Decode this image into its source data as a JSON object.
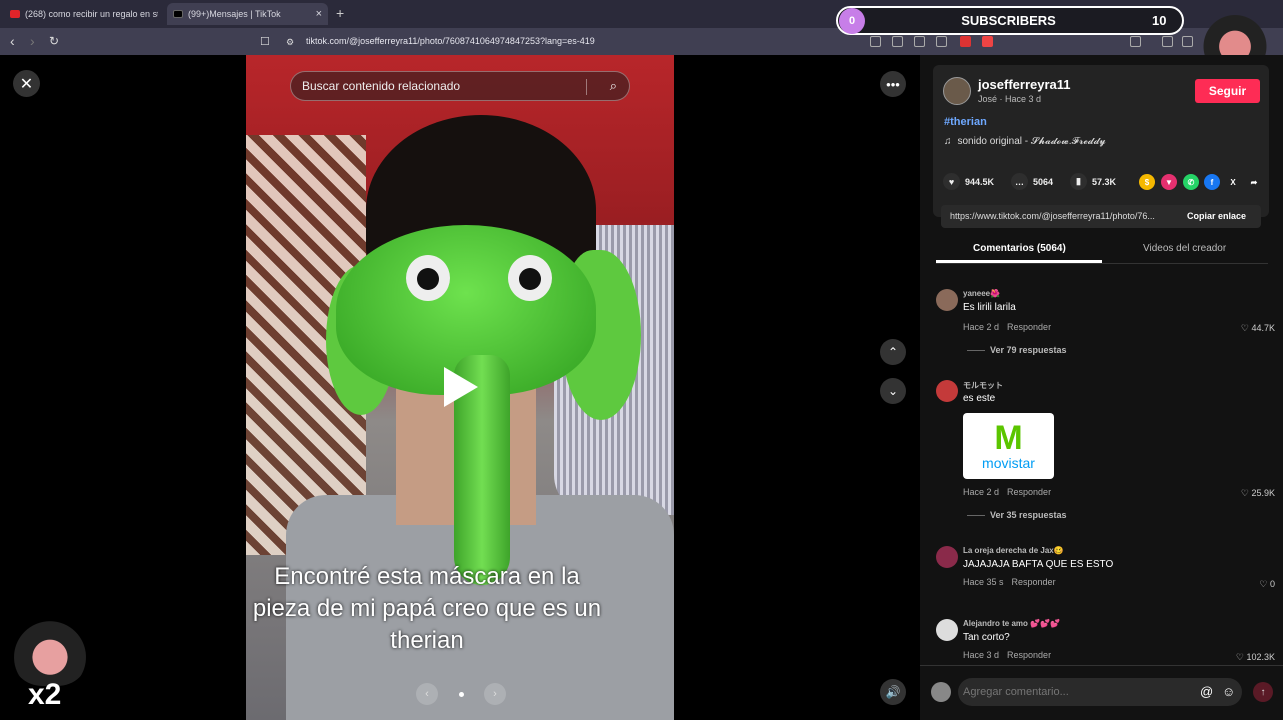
{
  "browser": {
    "tabs": [
      {
        "title": "(268) como recibir un regalo en steam",
        "active": false,
        "favicon_color": "#e0242a"
      },
      {
        "title": "(99+)Mensajes | TikTok",
        "active": true,
        "favicon_color": "#000000"
      }
    ],
    "new_tab": "+",
    "url": "tiktok.com/@josefferreyra11/photo/7608741064974847253?lang=es-419"
  },
  "overlay": {
    "subscribers_label": "SUBSCRIBERS",
    "subscribers_progress": "0",
    "subscribers_count": "10",
    "multiplier": "x2"
  },
  "viewer": {
    "search_placeholder": "Buscar contenido relacionado",
    "caption": "Encontré esta máscara en la pieza de mi papá creo que es un therian"
  },
  "author": {
    "username": "josefferreyra11",
    "subline": "José · Hace 3 d",
    "follow_label": "Seguir",
    "hashtag": "#therian",
    "sound": "sonido original - 𝓢𝓱𝓪𝓭𝓸𝔀.𝓕𝓻𝓮𝓭𝓭𝔂"
  },
  "stats": {
    "likes": "944.5K",
    "comments": "5064",
    "saves": "57.3K"
  },
  "link": {
    "url": "https://www.tiktok.com/@josefferreyra11/photo/76...",
    "copy_label": "Copiar enlace"
  },
  "comment_tabs": {
    "comments": "Comentarios (5064)",
    "creator_videos": "Videos del creador"
  },
  "comments": [
    {
      "user": "yaneee🌺",
      "text": "Es lirili larila",
      "time": "Hace 2 d",
      "reply": "Responder",
      "likes": "44.7K",
      "replies": "Ver 79 respuestas",
      "avatar_color": "#8a6a5a"
    },
    {
      "user": "モルモット",
      "text": "es este",
      "time": "Hace 2 d",
      "reply": "Responder",
      "likes": "25.9K",
      "replies": "Ver 35 respuestas",
      "image_brand": "movistar",
      "avatar_color": "#c43a3a"
    },
    {
      "user": "La oreja derecha de Jax🥴",
      "text": "JAJAJAJA BAFTA QUE ES ESTO",
      "time": "Hace 35 s",
      "reply": "Responder",
      "likes": "0",
      "avatar_color": "#8a2a4a"
    },
    {
      "user": "Alejandro te amo 💕💕💕",
      "text": "Tan corto?",
      "time": "Hace 3 d",
      "reply": "Responder",
      "likes": "102.3K",
      "avatar_color": "#dddddd"
    }
  ],
  "composer": {
    "placeholder": "Agregar comentario..."
  }
}
